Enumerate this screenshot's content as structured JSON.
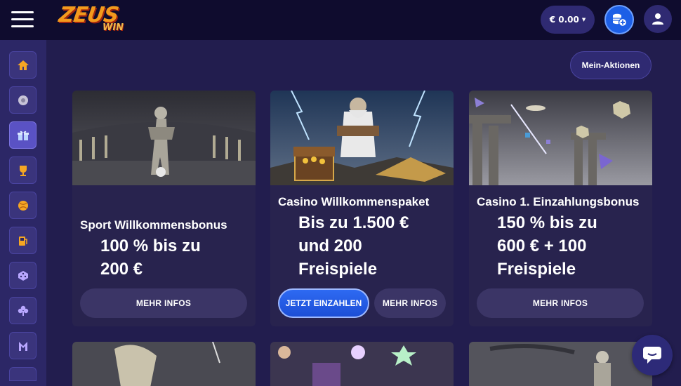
{
  "header": {
    "logo_text": "ZEUS",
    "logo_sub": "WIN",
    "balance": "€ 0.00"
  },
  "icons": {
    "menu": "hamburger-icon",
    "deposit": "coins-plus-icon",
    "user": "user-icon",
    "chat": "chat-icon"
  },
  "sidebar": {
    "items": [
      {
        "icon": "home-icon"
      },
      {
        "icon": "sports-icon"
      },
      {
        "icon": "gift-icon",
        "active": true
      },
      {
        "icon": "trophy-icon"
      },
      {
        "icon": "ball-icon"
      },
      {
        "icon": "fuel-icon"
      },
      {
        "icon": "dice-icon"
      },
      {
        "icon": "clover-icon"
      },
      {
        "icon": "app-icon"
      }
    ]
  },
  "actions_label": "Mein-Aktionen",
  "cards": [
    {
      "title": "Sport Willkommensbonus",
      "offer_1": "100 % bis zu",
      "offer_2": "200 €",
      "offer_3": "",
      "info_label": "MEHR INFOS"
    },
    {
      "title": "Casino Willkommenspaket",
      "offer_1": "Bis zu 1.500 €",
      "offer_2": "und 200",
      "offer_3": "Freispiele",
      "deposit_label": "JETZT EINZAHLEN",
      "info_label": "MEHR INFOS"
    },
    {
      "title": "Casino 1. Einzahlungsbonus",
      "offer_1": "150 % bis zu",
      "offer_2": "600 € + 100",
      "offer_3": "Freispiele",
      "info_label": "MEHR INFOS"
    }
  ],
  "colors": {
    "background": "#221d4e",
    "topbar": "#0f0c2e",
    "accent_blue": "#1d5fe6",
    "logo_orange": "#f39a1d"
  }
}
